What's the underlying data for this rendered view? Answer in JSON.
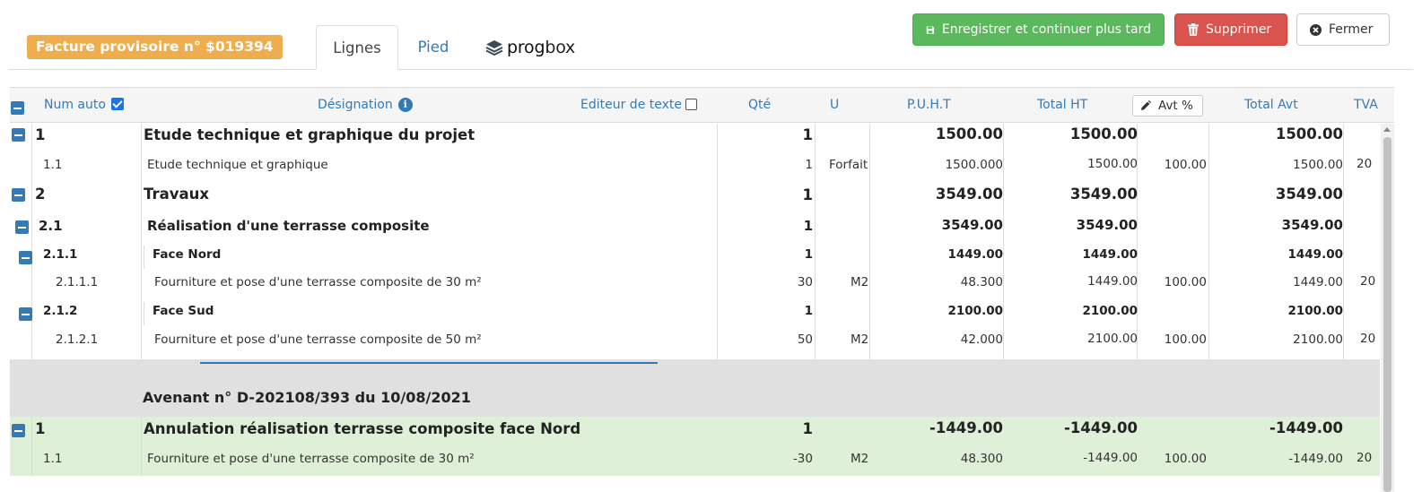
{
  "header": {
    "badge": "Facture provisoire n° $019394",
    "tabs": [
      {
        "label": "Lignes",
        "active": true
      },
      {
        "label": "Pied",
        "active": false
      }
    ],
    "logo_text_1": "prog",
    "logo_text_2": "box",
    "buttons": {
      "save": "Enregistrer et continuer plus tard",
      "delete": "Supprimer",
      "close": "Fermer"
    }
  },
  "columns": {
    "num_auto": "Num auto",
    "designation": "Désignation",
    "editeur": "Editeur de texte",
    "qte": "Qté",
    "u": "U",
    "puht": "P.U.H.T",
    "total_ht": "Total HT",
    "avt_pct": "Avt %",
    "total_avt": "Total Avt",
    "tva": "TVA"
  },
  "rows": [
    {
      "num": "1",
      "designation": "Etude technique et graphique du projet",
      "qte": "1",
      "u": "",
      "puht": "1500.00",
      "total_ht": "1500.00",
      "avt": "",
      "total_avt": "1500.00",
      "tva": ""
    },
    {
      "num": "1.1",
      "designation": "Etude technique et graphique",
      "qte": "1",
      "u": "Forfait",
      "puht": "1500.000",
      "total_ht": "1500.00",
      "avt": "100.00",
      "total_avt": "1500.00",
      "tva": "20"
    },
    {
      "num": "2",
      "designation": "Travaux",
      "qte": "1",
      "u": "",
      "puht": "3549.00",
      "total_ht": "3549.00",
      "avt": "",
      "total_avt": "3549.00",
      "tva": ""
    },
    {
      "num": "2.1",
      "designation": "Réalisation d'une terrasse composite",
      "qte": "1",
      "u": "",
      "puht": "3549.00",
      "total_ht": "3549.00",
      "avt": "",
      "total_avt": "3549.00",
      "tva": ""
    },
    {
      "num": "2.1.1",
      "designation": "Face Nord",
      "qte": "1",
      "u": "",
      "puht": "1449.00",
      "total_ht": "1449.00",
      "avt": "",
      "total_avt": "1449.00",
      "tva": ""
    },
    {
      "num": "2.1.1.1",
      "designation": "Fourniture et pose d'une terrasse composite de 30 m²",
      "qte": "30",
      "u": "M2",
      "puht": "48.300",
      "total_ht": "1449.00",
      "avt": "100.00",
      "total_avt": "1449.00",
      "tva": "20"
    },
    {
      "num": "2.1.2",
      "designation": "Face Sud",
      "qte": "1",
      "u": "",
      "puht": "2100.00",
      "total_ht": "2100.00",
      "avt": "",
      "total_avt": "2100.00",
      "tva": ""
    },
    {
      "num": "2.1.2.1",
      "designation": "Fourniture et pose d'une terrasse composite de 50 m²",
      "qte": "50",
      "u": "M2",
      "puht": "42.000",
      "total_ht": "2100.00",
      "avt": "100.00",
      "total_avt": "2100.00",
      "tva": "20"
    }
  ],
  "avenant": {
    "title": "Avenant n° D-202108/393 du 10/08/2021",
    "rows": [
      {
        "num": "1",
        "designation": "Annulation réalisation terrasse composite face Nord",
        "qte": "1",
        "u": "",
        "puht": "-1449.00",
        "total_ht": "-1449.00",
        "avt": "",
        "total_avt": "-1449.00",
        "tva": ""
      },
      {
        "num": "1.1",
        "designation": "Fourniture et pose d'une terrasse composite de 30 m²",
        "qte": "-30",
        "u": "M2",
        "puht": "48.300",
        "total_ht": "-1449.00",
        "avt": "100.00",
        "total_avt": "-1449.00",
        "tva": "20"
      }
    ]
  },
  "icons": {
    "save": "floppy-disk-icon",
    "delete": "trash-icon",
    "close": "close-circle-icon",
    "info": "info-icon",
    "edit": "pencil-icon",
    "collapse": "minus-square-icon"
  },
  "colors": {
    "badge": "#f0ad4e",
    "success": "#5cb85c",
    "danger": "#d9534f",
    "link": "#337ab7",
    "avenant_bg": "#dff0d8"
  }
}
